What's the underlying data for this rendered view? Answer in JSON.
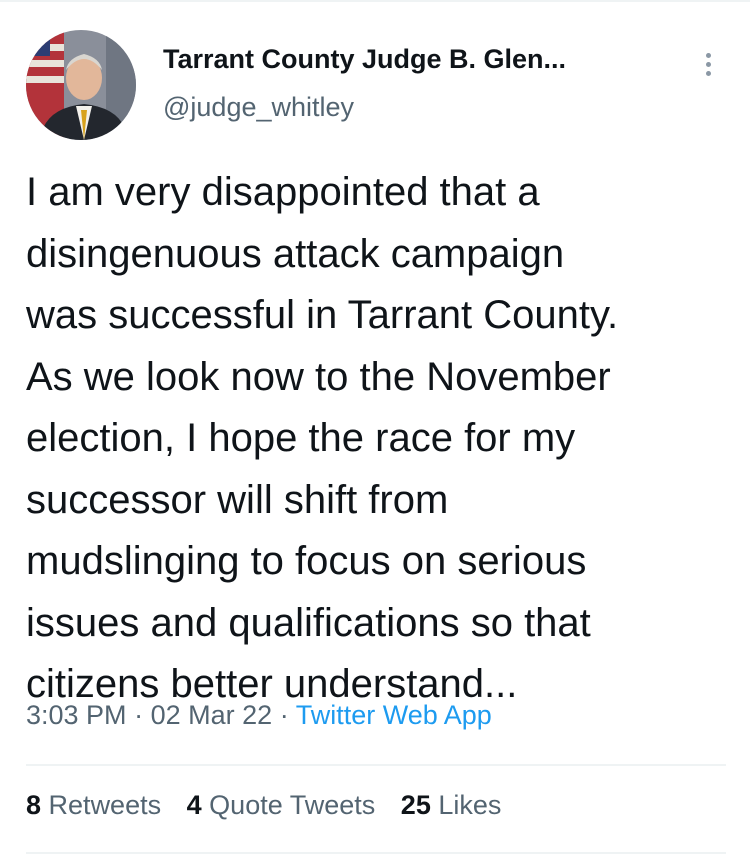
{
  "author": {
    "name": "Tarrant County Judge B. Glen...",
    "handle": "@judge_whitley"
  },
  "tweet": {
    "lines": [
      "I am very disappointed that a",
      "disingenuous attack campaign",
      "was successful in Tarrant County.",
      "As we look now to the November",
      "election, I hope the race for my",
      "successor will shift from",
      "mudslinging to focus on serious",
      "issues and qualifications so that",
      "citizens better understand..."
    ],
    "time": "3:03 PM",
    "date": "02 Mar 22",
    "source": "Twitter Web App",
    "separator": "·"
  },
  "stats": {
    "retweets": {
      "count": "8",
      "label": "Retweets"
    },
    "quotes": {
      "count": "4",
      "label": "Quote Tweets"
    },
    "likes": {
      "count": "25",
      "label": "Likes"
    }
  },
  "icons": {
    "more": "more-vertical-icon",
    "avatar": "avatar-photo"
  },
  "colors": {
    "text": "#0f1419",
    "secondary": "#536471",
    "link": "#1d9bf0",
    "divider": "#eff3f4"
  }
}
